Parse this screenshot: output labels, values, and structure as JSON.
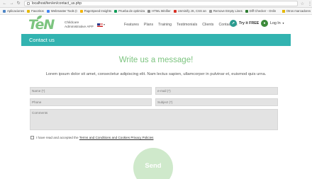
{
  "browser": {
    "url": "localhost/ten/en/contact_us.php",
    "bookmarks": [
      {
        "label": "Aplicaciones",
        "color": "#4f86c6"
      },
      {
        "label": "Favoritos",
        "color": "#e6b800"
      },
      {
        "label": "Webmaster Tools (t",
        "color": "#4285f4"
      },
      {
        "label": "PageSpeed Insights",
        "color": "#f4b400"
      },
      {
        "label": "Prueba de optimiza",
        "color": "#0f9d58"
      },
      {
        "label": "HTML Minifier",
        "color": "#888888"
      },
      {
        "label": "Unminify JS, CSS an",
        "color": "#d93025"
      },
      {
        "label": "Remove Empty Lines",
        "color": "#999999"
      },
      {
        "label": "Diff Checker - Onlin",
        "color": "#2e7d32"
      }
    ],
    "bookmarks_other": "Otros marcadores"
  },
  "header": {
    "logo": "TeN",
    "tagline_line1": "Childcare",
    "tagline_line2": "Administrative APP",
    "nav": [
      "Features",
      "Plans",
      "Training",
      "Testimonials",
      "Clients",
      "Contact Us"
    ],
    "try_free": "Try it FREE",
    "login": "Log In"
  },
  "banner": {
    "title": "Contact us"
  },
  "form": {
    "title": "Write us a message!",
    "intro": "Lorem ipsum dolor sit amet, consectetur adipiscing elit. Nam lectus sapien, ullamcorper in pulvinar et, euismod quis urna.",
    "name_placeholder": "Name (*)",
    "email_placeholder": "e-mail (*)",
    "phone_placeholder": "Phone",
    "subject_placeholder": "Subject (*)",
    "comments_placeholder": "Comments",
    "consent_prefix": "I have read and accepted the",
    "consent_link": "Terms and Conditions and Cookies Privacy Policies",
    "send_label": "Send"
  },
  "colors": {
    "teal": "#32b3b0",
    "green": "#7cc47f",
    "send_bg": "#cfe9cb"
  }
}
